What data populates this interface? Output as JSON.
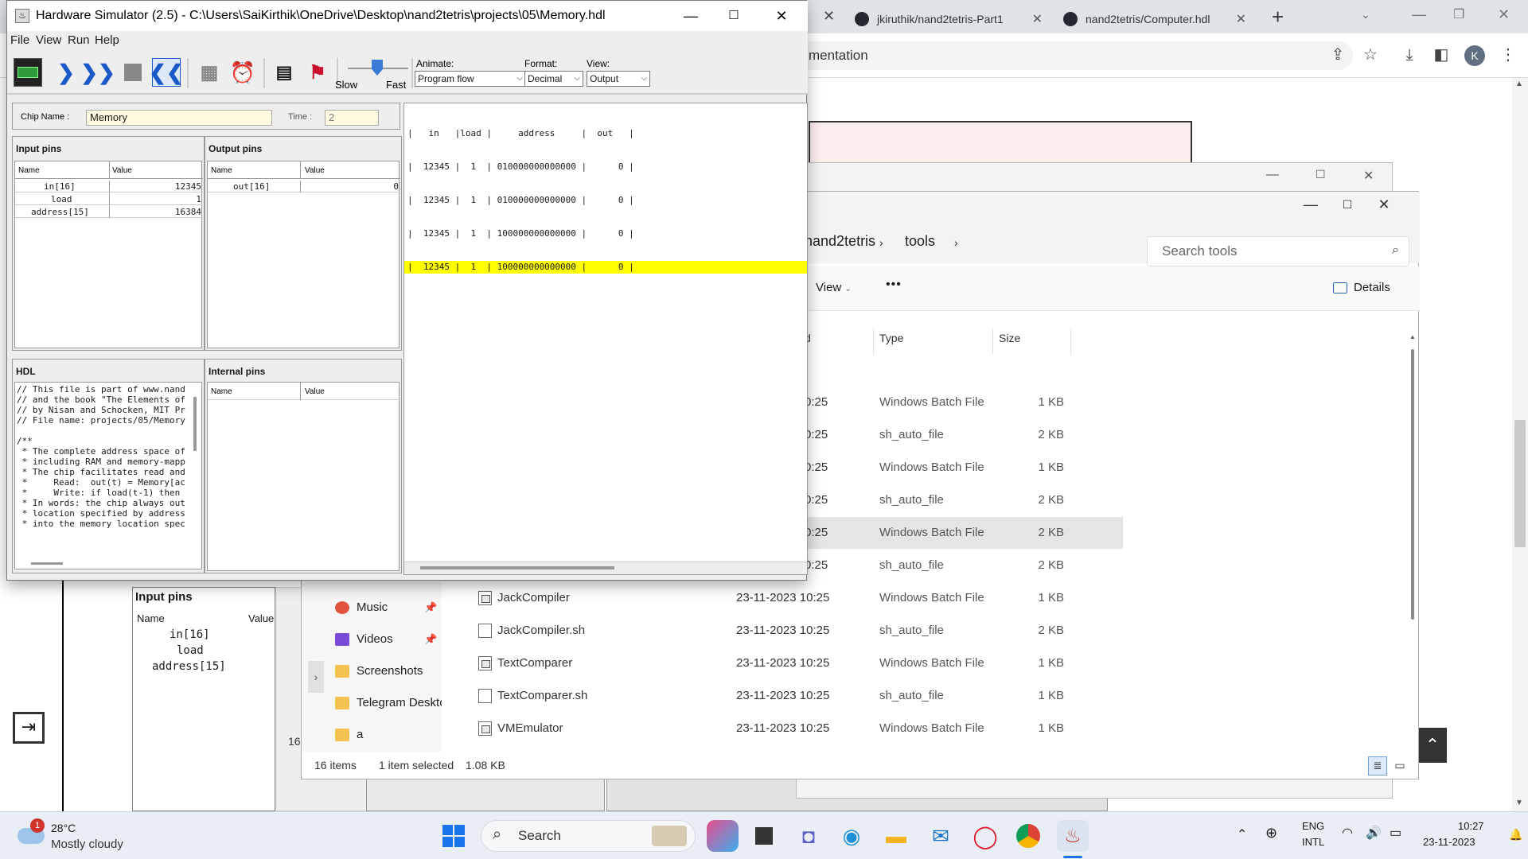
{
  "browser": {
    "tabs": [
      {
        "label": "jkiruthik/nand2tetris-Part1"
      },
      {
        "label": "nand2tetris/Computer.hdl"
      }
    ],
    "new_tab_icon": "plus-icon",
    "address_text": "mentation",
    "profile_initial": "K"
  },
  "background_sim": {
    "input_pins_title": "Input pins",
    "name_header": "Name",
    "value_header": "Value",
    "pins": [
      "in[16]",
      "load",
      "address[15]"
    ],
    "side_number": "16"
  },
  "explorer": {
    "breadcrumb": [
      "nand2tetris",
      "tools"
    ],
    "search_placeholder": "Search tools",
    "view_label": "View",
    "more_label": "•••",
    "details_label": "Details",
    "columns": {
      "date": "d",
      "type": "Type",
      "size": "Size"
    },
    "partial_rows": [
      {
        "date": "0:25",
        "type": "Windows Batch File",
        "size": "1 KB"
      },
      {
        "date": "0:25",
        "type": "sh_auto_file",
        "size": "2 KB"
      },
      {
        "date": "0:25",
        "type": "Windows Batch File",
        "size": "1 KB"
      },
      {
        "date": "0:25",
        "type": "sh_auto_file",
        "size": "2 KB"
      },
      {
        "date": "0:25",
        "type": "Windows Batch File",
        "size": "2 KB"
      },
      {
        "date": "0:25",
        "type": "sh_auto_file",
        "size": "2 KB"
      }
    ],
    "files": [
      {
        "name": "JackCompiler",
        "date": "23-11-2023 10:25",
        "type": "Windows Batch File",
        "size": "1 KB",
        "icon": "batch"
      },
      {
        "name": "JackCompiler.sh",
        "date": "23-11-2023 10:25",
        "type": "sh_auto_file",
        "size": "2 KB",
        "icon": "file"
      },
      {
        "name": "TextComparer",
        "date": "23-11-2023 10:25",
        "type": "Windows Batch File",
        "size": "1 KB",
        "icon": "batch"
      },
      {
        "name": "TextComparer.sh",
        "date": "23-11-2023 10:25",
        "type": "sh_auto_file",
        "size": "1 KB",
        "icon": "file"
      },
      {
        "name": "VMEmulator",
        "date": "23-11-2023 10:25",
        "type": "Windows Batch File",
        "size": "1 KB",
        "icon": "batch"
      }
    ],
    "nav": [
      {
        "label": "Music",
        "icon": "music-icon",
        "color": "#e0533f",
        "pinned": true
      },
      {
        "label": "Videos",
        "icon": "video-icon",
        "color": "#7a4bd8",
        "pinned": true
      },
      {
        "label": "Screenshots",
        "icon": "folder-icon",
        "color": "#f2c14e",
        "pinned": false
      },
      {
        "label": "Telegram Deskto",
        "icon": "folder-icon",
        "color": "#f2c14e",
        "pinned": false
      },
      {
        "label": "a",
        "icon": "folder-icon",
        "color": "#f2c14e",
        "pinned": false
      }
    ],
    "status": {
      "count": "16 items",
      "selected": "1 item selected",
      "size": "1.08 KB"
    }
  },
  "hws": {
    "title": "Hardware Simulator (2.5) - C:\\Users\\SaiKirthik\\OneDrive\\Desktop\\nand2tetris\\projects\\05\\Memory.hdl",
    "menu": [
      "File",
      "View",
      "Run",
      "Help"
    ],
    "speed_slow": "Slow",
    "speed_fast": "Fast",
    "animate_label": "Animate:",
    "animate_value": "Program flow",
    "format_label": "Format:",
    "format_value": "Decimal",
    "view_label": "View:",
    "view_value": "Output",
    "chip_name_label": "Chip Name :",
    "chip_name_value": "Memory",
    "time_label": "Time :",
    "time_value": "2",
    "input_pins_title": "Input pins",
    "output_pins_title": "Output pins",
    "hdl_title": "HDL",
    "internal_pins_title": "Internal pins",
    "name_hdr": "Name",
    "value_hdr": "Value",
    "input_pins": [
      {
        "name": "in[16]",
        "value": "12345"
      },
      {
        "name": "load",
        "value": "1"
      },
      {
        "name": "address[15]",
        "value": "16384"
      }
    ],
    "output_pins": [
      {
        "name": "out[16]",
        "value": "0"
      }
    ],
    "hdl_lines": [
      "// This file is part of www.nand",
      "// and the book \"The Elements of",
      "// by Nisan and Schocken, MIT Pr",
      "// File name: projects/05/Memory",
      "",
      "/**",
      " * The complete address space of",
      " * including RAM and memory-mapp",
      " * The chip facilitates read and",
      " *     Read:  out(t) = Memory[ac",
      " *     Write: if load(t-1) then",
      " * In words: the chip always out",
      " * location specified by address",
      " * into the memory location spec"
    ],
    "output_log": [
      "|   in   |load |     address     |  out   |",
      "|  12345 |  1  | 010000000000000 |      0 |",
      "|  12345 |  1  | 010000000000000 |      0 |",
      "|  12345 |  1  | 100000000000000 |      0 |",
      "|  12345 |  1  | 100000000000000 |      0 |"
    ]
  },
  "taskbar": {
    "weather_temp": "28°C",
    "weather_desc": "Mostly cloudy",
    "weather_badge": "1",
    "search_label": "Search",
    "lang_top": "ENG",
    "lang_bottom": "INTL",
    "time": "10:27",
    "date": "23-11-2023"
  }
}
